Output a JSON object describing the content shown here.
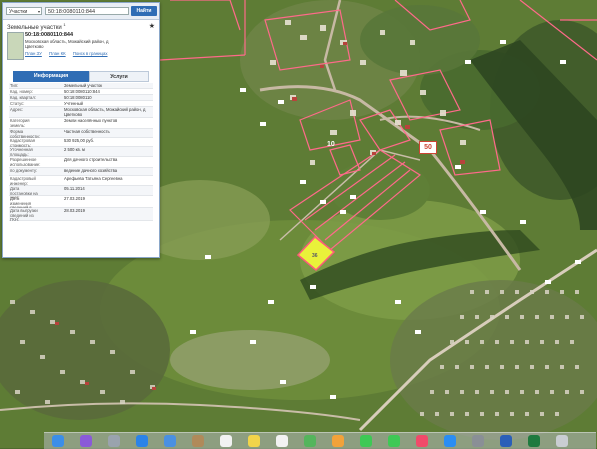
{
  "search": {
    "category": "Участки",
    "query": "50:18:0080110:844",
    "button": "Найти"
  },
  "panel": {
    "title": "Земельные участки",
    "title_sup": "1",
    "parcel_number": "50:18:0080110:844",
    "parcel_address": "Московская область, Можайский район, д Цветково",
    "links": [
      "План ЗУ",
      "План КК",
      "Поиск в границах"
    ],
    "tabs": [
      "Информация",
      "Услуги"
    ],
    "rows": [
      {
        "k": "Тип:",
        "v": "Земельный участок"
      },
      {
        "k": "Кад. номер:",
        "v": "50:18:0080110:844"
      },
      {
        "k": "Кад. квартал:",
        "v": "50:18:0080110"
      },
      {
        "k": "Статус:",
        "v": "Учтенный"
      },
      {
        "k": "Адрес:",
        "v": "Московская область, Можайский район, д Цветково"
      },
      {
        "k": "Категория земель:",
        "v": "Земли населённых пунктов"
      },
      {
        "k": "Форма собственности:",
        "v": "Частная собственность"
      },
      {
        "k": "Кадастровая стоимость:",
        "v": "530 925,00 руб."
      },
      {
        "k": "Уточненная площадь:",
        "v": "2 500 кв. м"
      },
      {
        "k": "Разрешенное использование:",
        "v": "Для дачного строительства"
      },
      {
        "k": "по документу:",
        "v": "ведение дачного хозяйства"
      },
      {
        "k": "Кадастровый инженер:",
        "v": "Арефьева Татьяна Сергеевна"
      },
      {
        "k": "Дата постановки на учет:",
        "v": "05.11.2014"
      },
      {
        "k": "Дата изменения сведений в ГКН:",
        "v": "27.03.2019"
      },
      {
        "k": "Дата выгрузки сведений из ГКН:",
        "v": "28.03.2019"
      }
    ]
  },
  "map": {
    "labels": {
      "quarter_number": "10",
      "parcel_label": "36",
      "badge": "50"
    }
  },
  "dock": {
    "icons": [
      "finder-icon",
      "siri-icon",
      "launchpad-icon",
      "safari-icon",
      "mail-icon",
      "contacts-icon",
      "calendar-icon",
      "notes-icon",
      "reminders-icon",
      "maps-icon",
      "photos-icon",
      "messages-icon",
      "facetime-icon",
      "music-icon",
      "appstore-icon",
      "preferences-icon",
      "word-icon",
      "excel-icon",
      "trash-icon"
    ]
  }
}
